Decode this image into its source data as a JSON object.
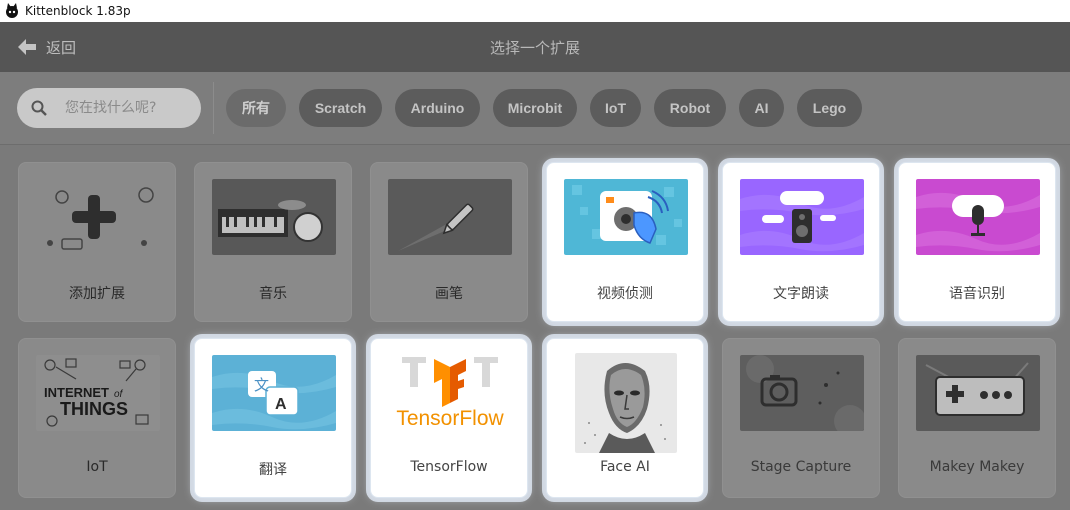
{
  "window": {
    "title": "Kittenblock 1.83p"
  },
  "header": {
    "back_label": "返回",
    "title": "选择一个扩展"
  },
  "search": {
    "placeholder": "您在找什么呢?"
  },
  "filters": [
    {
      "label": "所有"
    },
    {
      "label": "Scratch"
    },
    {
      "label": "Arduino"
    },
    {
      "label": "Microbit"
    },
    {
      "label": "IoT"
    },
    {
      "label": "Robot"
    },
    {
      "label": "AI"
    },
    {
      "label": "Lego"
    }
  ],
  "extensions": [
    {
      "label": "添加扩展",
      "icon": "plus-icon"
    },
    {
      "label": "音乐",
      "icon": "music-instruments-icon"
    },
    {
      "label": "画笔",
      "icon": "pen-icon"
    },
    {
      "label": "视频侦测",
      "icon": "video-sensing-icon"
    },
    {
      "label": "文字朗读",
      "icon": "text-to-speech-icon"
    },
    {
      "label": "语音识别",
      "icon": "speech-recognition-icon"
    },
    {
      "label": "IoT",
      "icon": "internet-of-things-icon"
    },
    {
      "label": "翻译",
      "icon": "translate-icon",
      "thumb_text": [
        "文",
        "A"
      ]
    },
    {
      "label": "TensorFlow",
      "icon": "tensorflow-icon",
      "thumb_text": "TensorFlow"
    },
    {
      "label": "Face AI",
      "icon": "face-ai-icon"
    },
    {
      "label": "Stage Capture",
      "icon": "camera-icon"
    },
    {
      "label": "Makey Makey",
      "icon": "makey-makey-icon"
    }
  ],
  "iot_thumb_text": [
    "INTERNET",
    "of",
    "THINGS"
  ],
  "colors": {
    "tensorflow_orange": "#f29100",
    "scratch_blue": "#4c97ff",
    "tts_purple": "#9966ff",
    "speech_pink": "#c94ad0",
    "translate_blue": "#5cb1d6"
  }
}
